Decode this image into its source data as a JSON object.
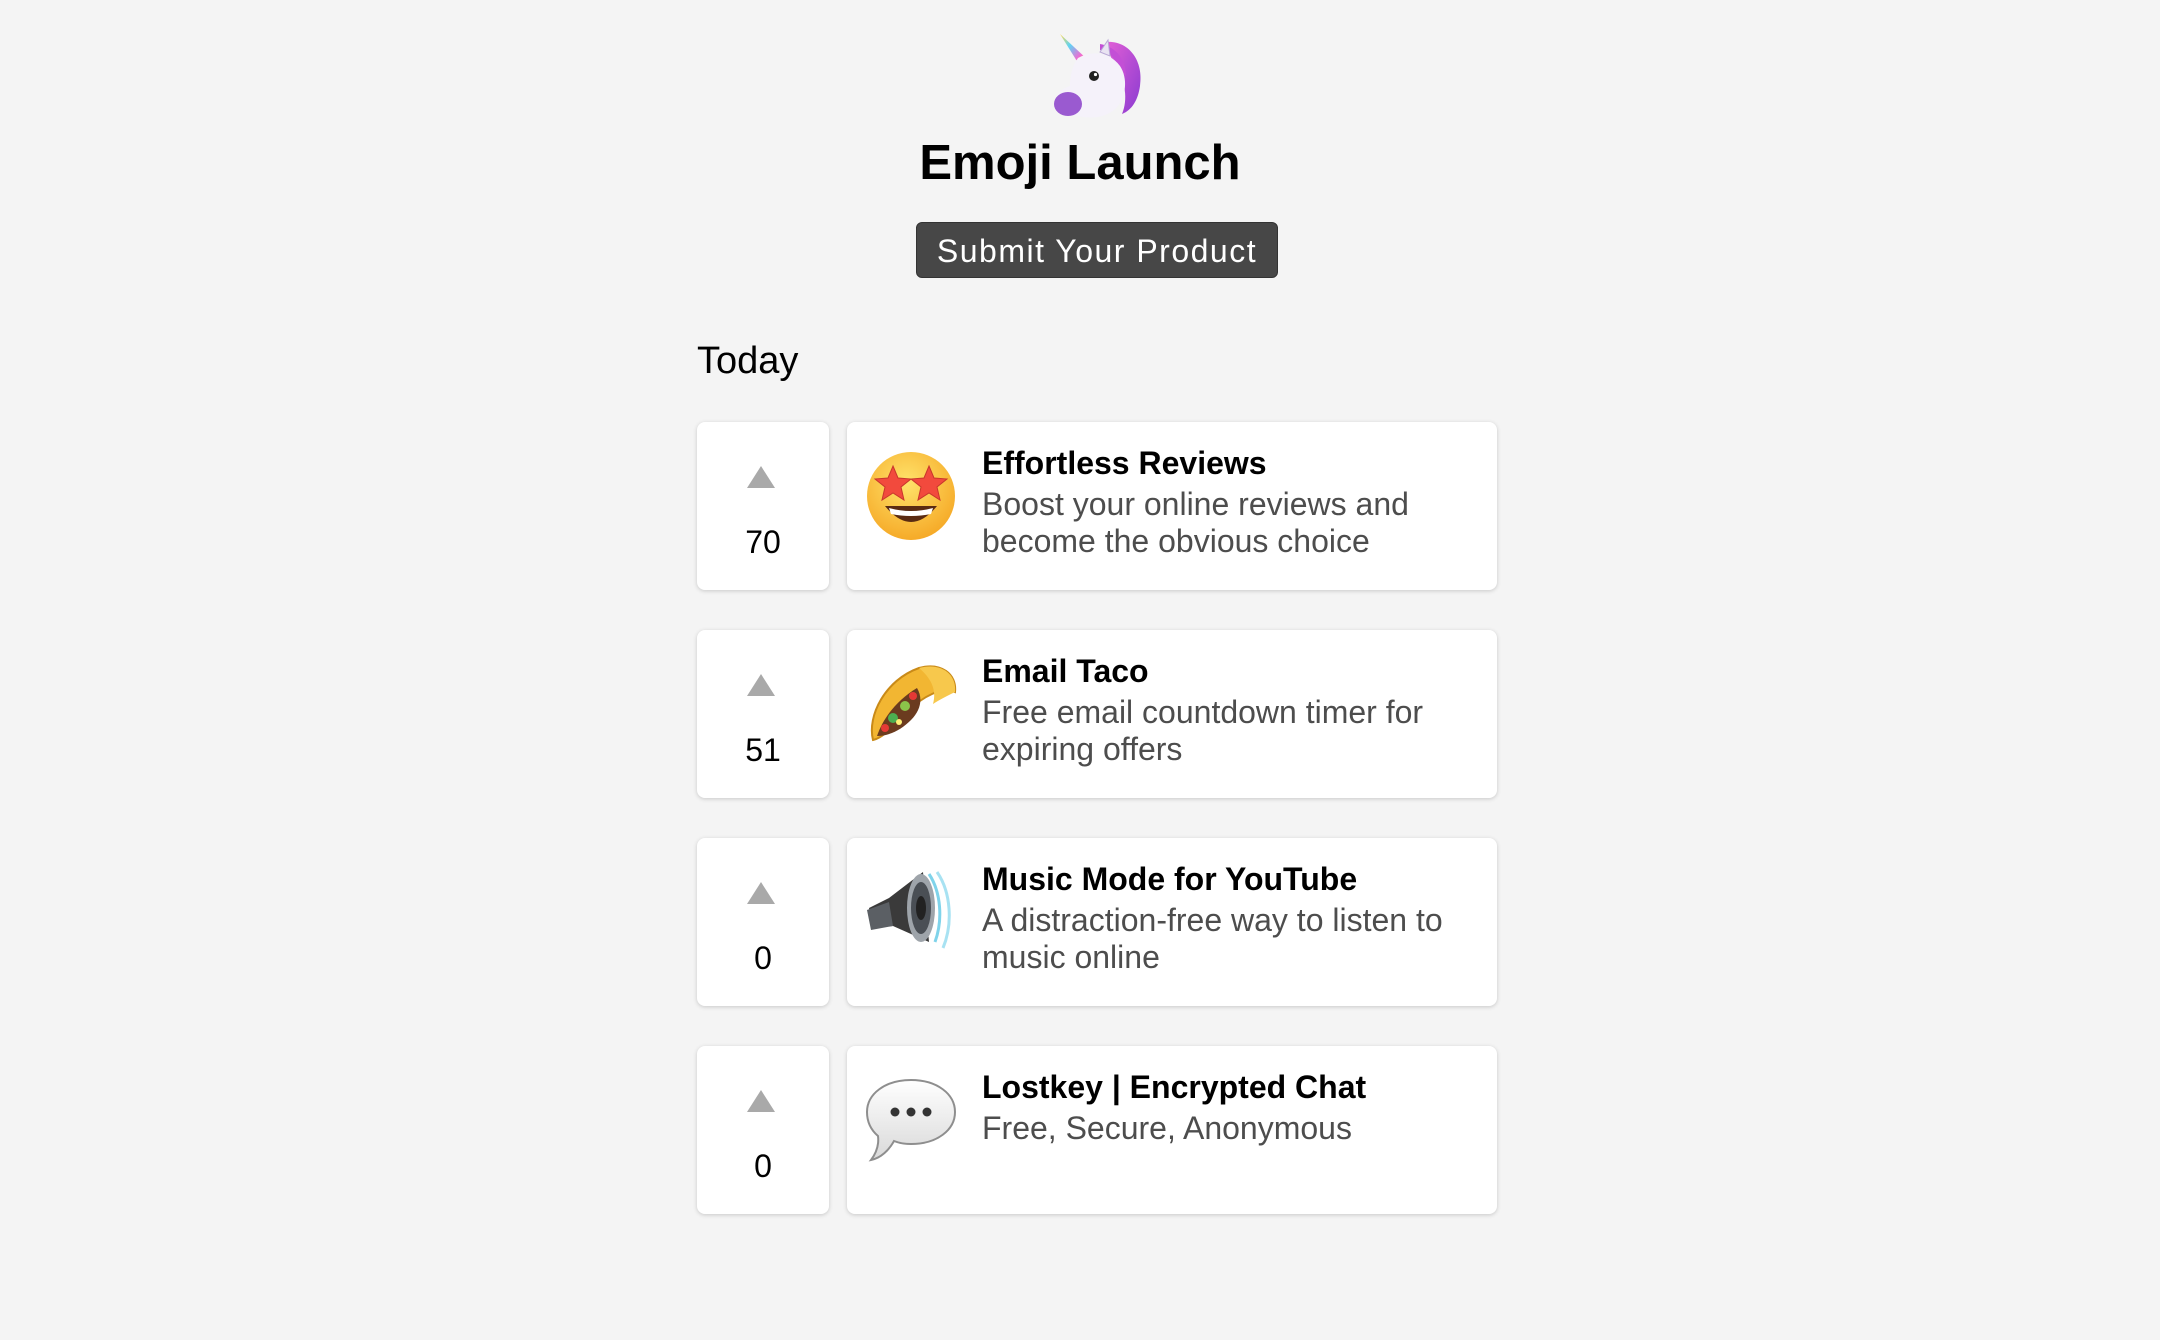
{
  "site": {
    "logo_icon": "unicorn-face-icon",
    "title": "Emoji Launch",
    "submit_label": "Submit Your Product"
  },
  "section": {
    "title": "Today"
  },
  "products": [
    {
      "name": "Effortless Reviews",
      "tagline": "Boost your online reviews and become the obvious choice",
      "votes": "70",
      "icon": "star-struck-face-icon"
    },
    {
      "name": "Email Taco",
      "tagline": "Free email countdown timer for expiring offers",
      "votes": "51",
      "icon": "taco-icon"
    },
    {
      "name": "Music Mode for YouTube",
      "tagline": "A distraction-free way to listen to music online",
      "votes": "0",
      "icon": "loud-speaker-icon"
    },
    {
      "name": "Lostkey | Encrypted Chat",
      "tagline": "Free, Secure, Anonymous",
      "votes": "0",
      "icon": "speech-bubble-icon"
    }
  ],
  "colors": {
    "background": "#f4f4f4",
    "button": "#474747",
    "tagline": "#4d4d4d",
    "vote_arrow": "#a9a9a9"
  }
}
